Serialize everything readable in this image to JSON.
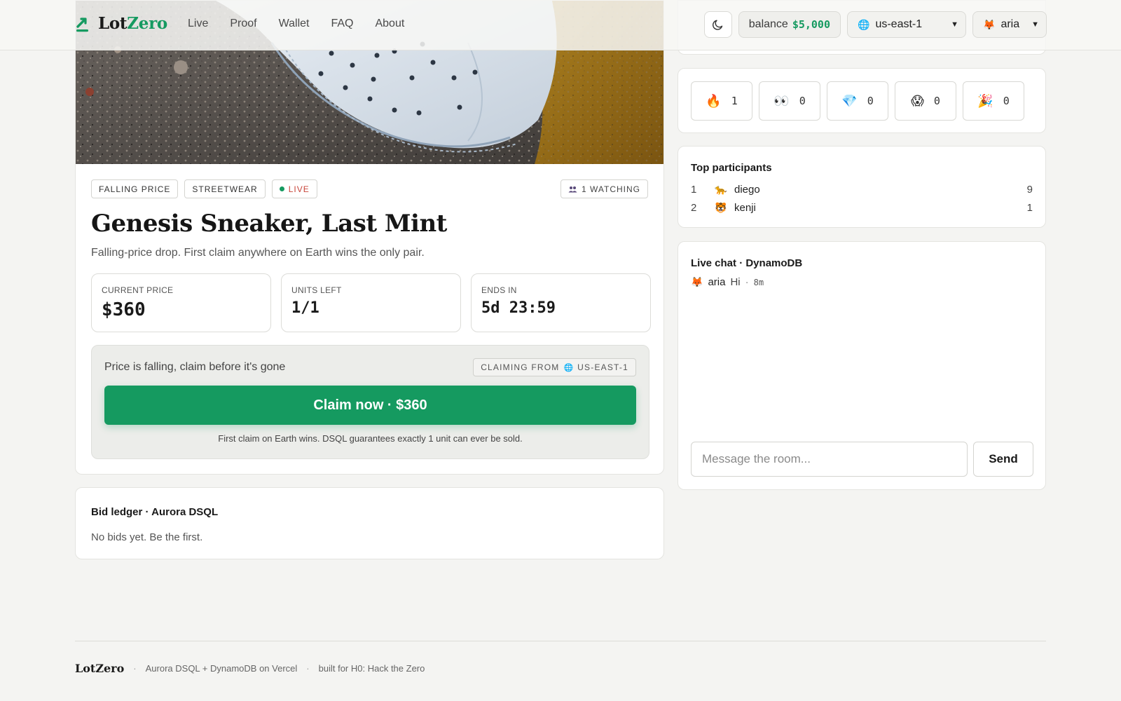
{
  "header": {
    "brand_part1": "Lot",
    "brand_part2": "Zero",
    "nav": [
      "Live",
      "Proof",
      "Wallet",
      "FAQ",
      "About"
    ],
    "balance_label": "balance",
    "balance_value": "$5,000",
    "region": "us-east-1",
    "user": "aria",
    "user_emoji": "🦊",
    "region_emoji": "🌐"
  },
  "lot": {
    "tags": [
      "FALLING PRICE",
      "STREETWEAR",
      "LIVE"
    ],
    "watching": "1 WATCHING",
    "title": "Genesis Sneaker, Last Mint",
    "subtitle": "Falling-price drop. First claim anywhere on Earth wins the only pair.",
    "stats": [
      {
        "label": "CURRENT PRICE",
        "value": "$360"
      },
      {
        "label": "UNITS LEFT",
        "value": "1/1"
      },
      {
        "label": "ENDS IN",
        "value": "5d 23:59"
      }
    ],
    "claim_hint": "Price is falling, claim before it's gone",
    "claiming_from": "CLAIMING FROM",
    "claiming_region": "US-EAST-1",
    "claim_button": "Claim now · $360",
    "claim_note": "First claim on Earth wins. DSQL guarantees exactly 1 unit can ever be sold."
  },
  "ledger": {
    "title": "Bid ledger · Aurora DSQL",
    "empty": "No bids yet. Be the first."
  },
  "reactions": [
    {
      "emoji": "🔥",
      "count": "1",
      "icon": "fire-icon"
    },
    {
      "emoji": "👀",
      "count": "0",
      "icon": "eyes-icon"
    },
    {
      "emoji": "💎",
      "count": "0",
      "icon": "gem-icon"
    },
    {
      "emoji": "😱",
      "count": "0",
      "icon": "scream-icon"
    },
    {
      "emoji": "🎉",
      "count": "0",
      "icon": "party-icon"
    }
  ],
  "participants": {
    "title": "Top participants",
    "rows": [
      {
        "rank": "1",
        "emoji": "🐆",
        "name": "diego",
        "count": "9"
      },
      {
        "rank": "2",
        "emoji": "🐯",
        "name": "kenji",
        "count": "1"
      }
    ]
  },
  "chat": {
    "title": "Live chat · DynamoDB",
    "messages": [
      {
        "emoji": "🦊",
        "user": "aria",
        "text": "Hi",
        "time": "8m"
      }
    ],
    "placeholder": "Message the room...",
    "send": "Send"
  },
  "footer": {
    "brand": "LotZero",
    "items": [
      "Aurora DSQL + DynamoDB on Vercel",
      "built for H0: Hack the Zero"
    ]
  },
  "colors": {
    "accent": "#159a60",
    "live": "#c8443a",
    "background": "#f4f4f2"
  }
}
